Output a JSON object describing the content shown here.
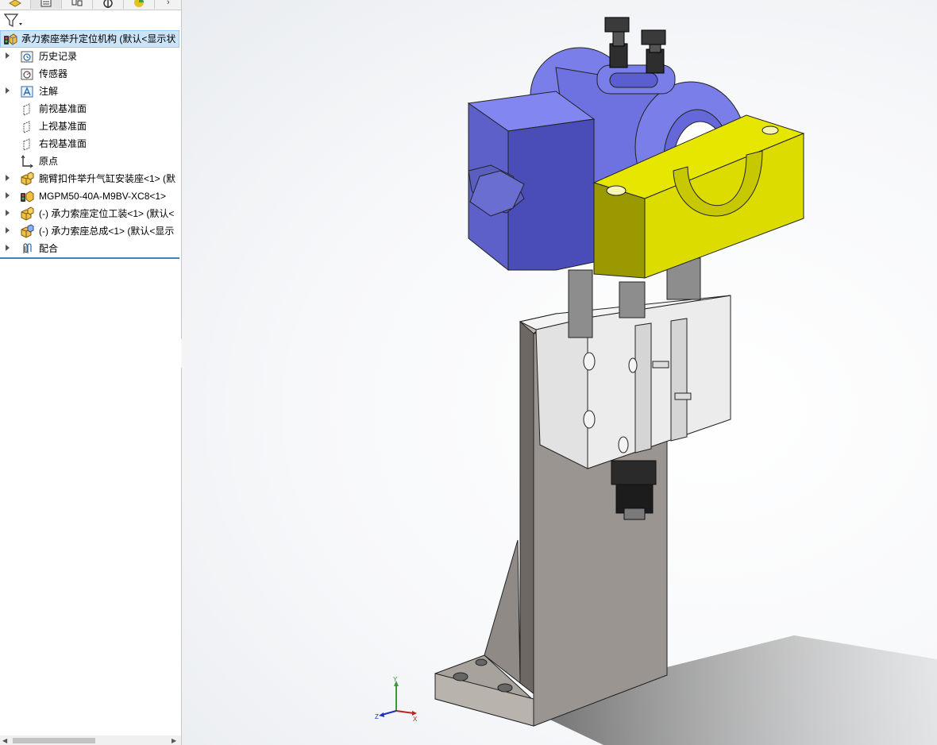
{
  "feature_tree": {
    "root": {
      "label": "承力索座举升定位机构  (默认<显示状",
      "icon": "assembly-icon"
    },
    "items": [
      {
        "label": "历史记录",
        "icon": "history-icon",
        "expandable": true
      },
      {
        "label": "传感器",
        "icon": "sensor-icon",
        "expandable": false
      },
      {
        "label": "注解",
        "icon": "annotation-icon",
        "expandable": true
      },
      {
        "label": "前视基准面",
        "icon": "plane-icon",
        "expandable": false
      },
      {
        "label": "上视基准面",
        "icon": "plane-icon",
        "expandable": false
      },
      {
        "label": "右视基准面",
        "icon": "plane-icon",
        "expandable": false
      },
      {
        "label": "原点",
        "icon": "origin-icon",
        "expandable": false
      },
      {
        "label": "腕臂扣件举升气缸安装座<1> (默",
        "icon": "subassembly-icon",
        "expandable": true
      },
      {
        "label": "MGPM50-40A-M9BV-XC8<1>",
        "icon": "component-icon",
        "expandable": true
      },
      {
        "label": "(-) 承力索座定位工装<1> (默认<",
        "icon": "subassembly-icon",
        "expandable": true
      },
      {
        "label": "(-) 承力索座总成<1> (默认<显示",
        "icon": "subassembly-icon",
        "expandable": true
      },
      {
        "label": "配合",
        "icon": "mates-icon",
        "expandable": true
      }
    ]
  },
  "triad": {
    "x": "X",
    "y": "Y",
    "z": "Z"
  },
  "colors": {
    "selection": "#cce4f7",
    "part_blue": "#7a7ee8",
    "part_yellow": "#e6e600",
    "steel": "#9a9590"
  }
}
